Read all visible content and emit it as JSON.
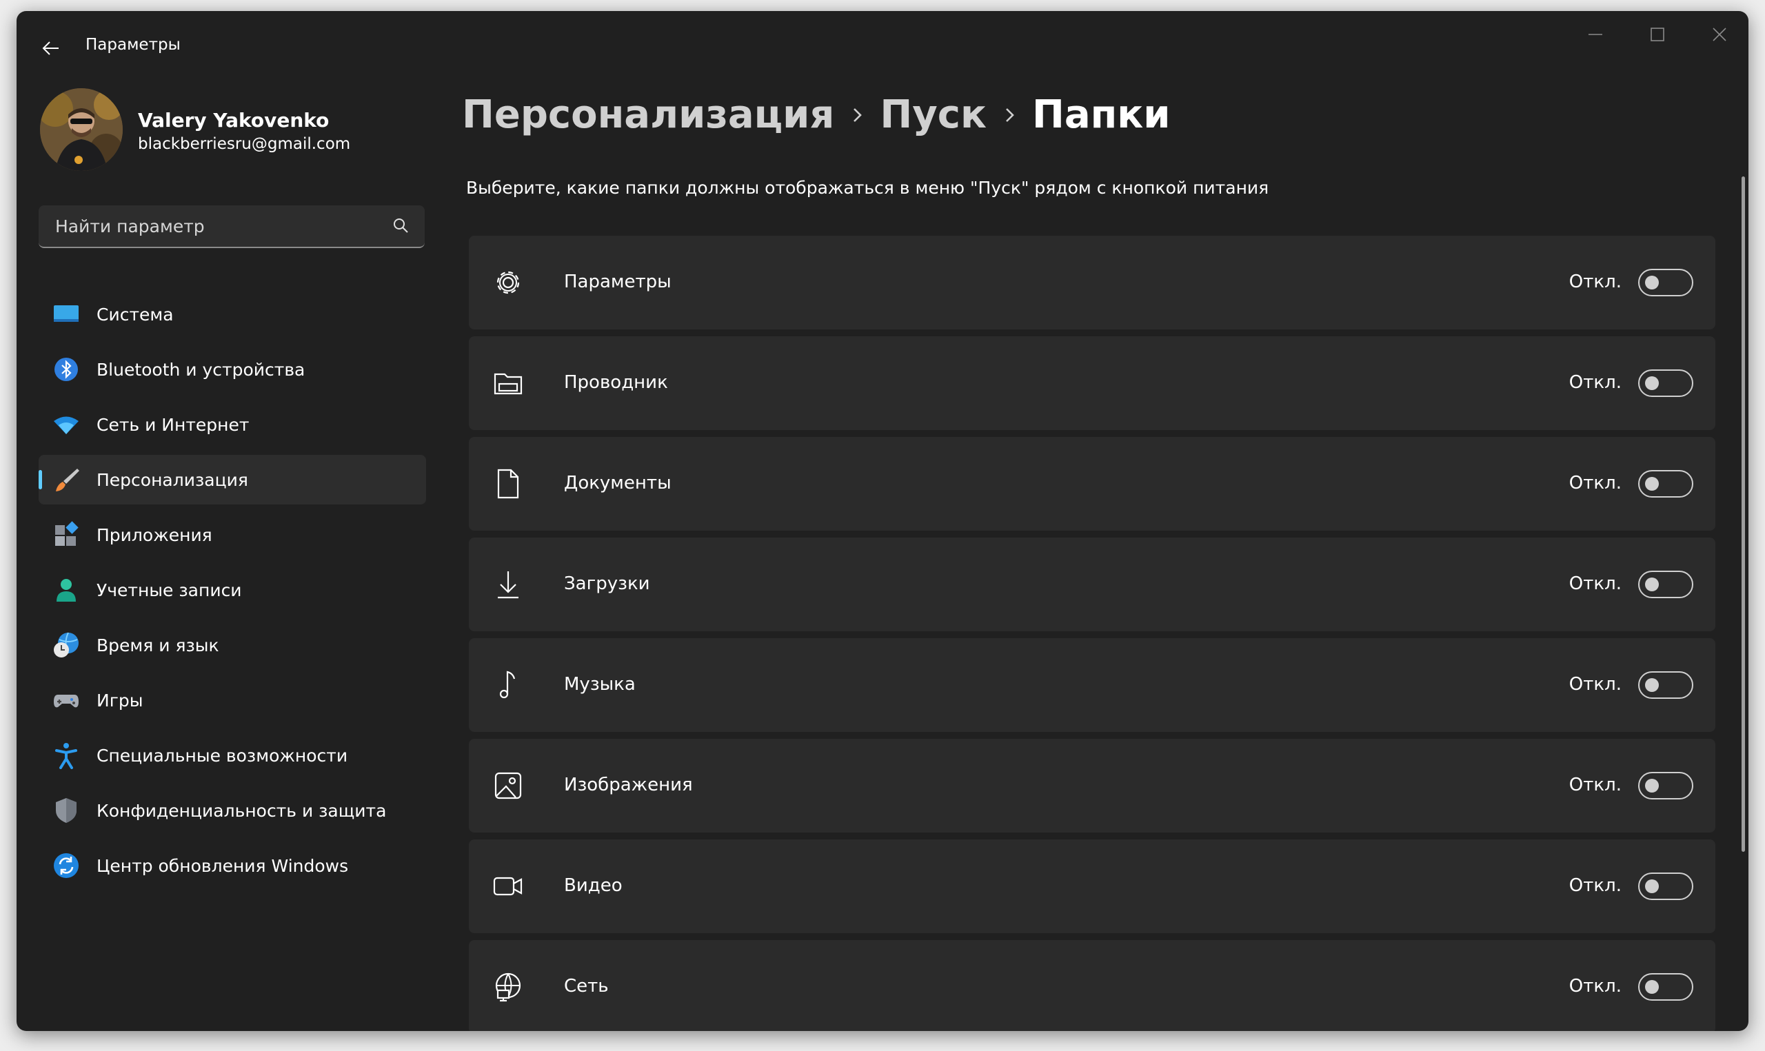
{
  "window": {
    "title": "Параметры",
    "controls": [
      "minimize-icon",
      "maximize-icon",
      "close-icon"
    ]
  },
  "user": {
    "name": "Valery Yakovenko",
    "email": "blackberriesru@gmail.com"
  },
  "search": {
    "placeholder": "Найти параметр"
  },
  "sidebar": {
    "items": [
      {
        "label": "Система",
        "icon": "system-icon"
      },
      {
        "label": "Bluetooth и устройства",
        "icon": "bluetooth-icon"
      },
      {
        "label": "Сеть и Интернет",
        "icon": "wifi-icon"
      },
      {
        "label": "Персонализация",
        "icon": "brush-icon",
        "active": true
      },
      {
        "label": "Приложения",
        "icon": "apps-icon"
      },
      {
        "label": "Учетные записи",
        "icon": "accounts-icon"
      },
      {
        "label": "Время и язык",
        "icon": "time-language-icon"
      },
      {
        "label": "Игры",
        "icon": "gamepad-icon"
      },
      {
        "label": "Специальные возможности",
        "icon": "accessibility-icon"
      },
      {
        "label": "Конфиденциальность и защита",
        "icon": "shield-icon"
      },
      {
        "label": "Центр обновления Windows",
        "icon": "update-icon"
      }
    ]
  },
  "breadcrumb": {
    "items": [
      "Персонализация",
      "Пуск",
      "Папки"
    ]
  },
  "main": {
    "subtitle": "Выберите, какие папки должны отображаться в меню \"Пуск\" рядом с кнопкой питания",
    "folders": [
      {
        "label": "Параметры",
        "icon": "gear-icon",
        "state": "Откл.",
        "on": false
      },
      {
        "label": "Проводник",
        "icon": "file-explorer-icon",
        "state": "Откл.",
        "on": false
      },
      {
        "label": "Документы",
        "icon": "document-icon",
        "state": "Откл.",
        "on": false
      },
      {
        "label": "Загрузки",
        "icon": "download-icon",
        "state": "Откл.",
        "on": false
      },
      {
        "label": "Музыка",
        "icon": "music-note-icon",
        "state": "Откл.",
        "on": false
      },
      {
        "label": "Изображения",
        "icon": "image-icon",
        "state": "Откл.",
        "on": false
      },
      {
        "label": "Видео",
        "icon": "video-icon",
        "state": "Откл.",
        "on": false
      },
      {
        "label": "Сеть",
        "icon": "network-globe-icon",
        "state": "Откл.",
        "on": false
      }
    ]
  },
  "colors": {
    "window_bg": "#202020",
    "card_bg": "#2b2b2b",
    "accent": "#60cdff"
  }
}
